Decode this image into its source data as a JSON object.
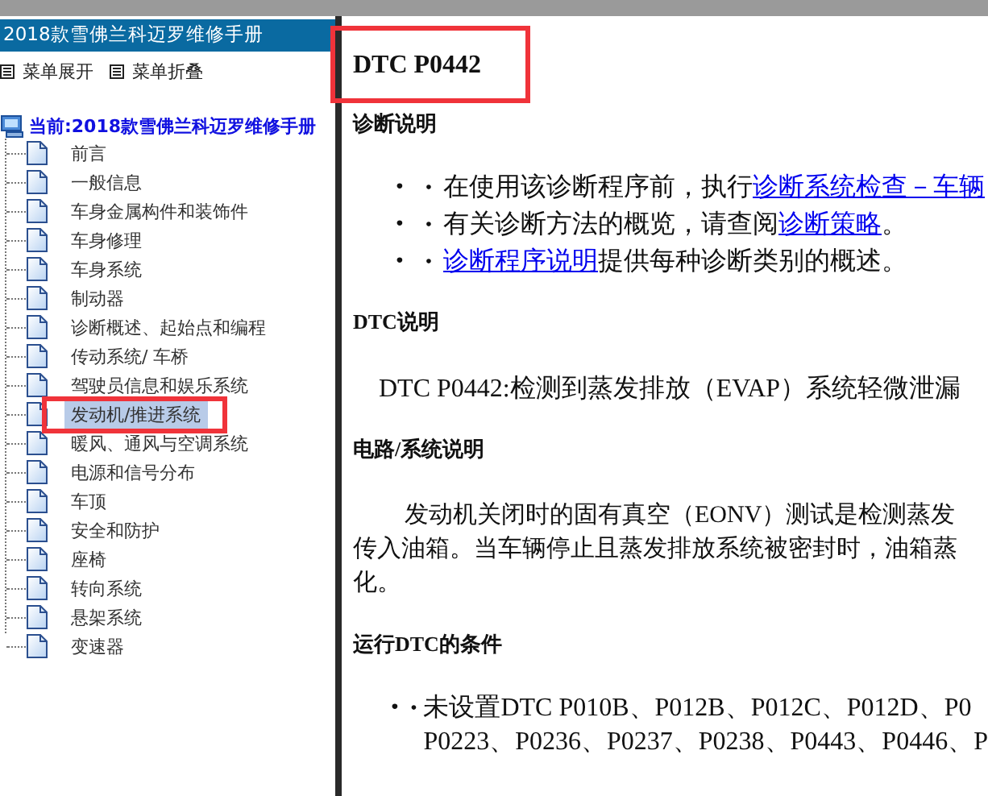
{
  "sidebar": {
    "title": "2018款雪佛兰科迈罗维修手册",
    "menu_buttons": [
      {
        "label": "菜单展开"
      },
      {
        "label": "菜单折叠"
      }
    ],
    "tree": {
      "label": "当前:2018款雪佛兰科迈罗维修手册",
      "children": [
        {
          "label": "前言",
          "selected": false
        },
        {
          "label": "一般信息",
          "selected": false
        },
        {
          "label": "车身金属构件和装饰件",
          "selected": false
        },
        {
          "label": "车身修理",
          "selected": false
        },
        {
          "label": "车身系统",
          "selected": false
        },
        {
          "label": "制动器",
          "selected": false
        },
        {
          "label": "诊断概述、起始点和编程",
          "selected": false
        },
        {
          "label": "传动系统/ 车桥",
          "selected": false
        },
        {
          "label": "驾驶员信息和娱乐系统",
          "selected": false
        },
        {
          "label": "发动机/推进系统",
          "selected": true,
          "framed": true
        },
        {
          "label": "暖风、通风与空调系统",
          "selected": false
        },
        {
          "label": "电源和信号分布",
          "selected": false
        },
        {
          "label": "车顶",
          "selected": false
        },
        {
          "label": "安全和防护",
          "selected": false
        },
        {
          "label": "座椅",
          "selected": false
        },
        {
          "label": "转向系统",
          "selected": false
        },
        {
          "label": "悬架系统",
          "selected": false
        },
        {
          "label": "变速器",
          "selected": false
        }
      ]
    }
  },
  "content": {
    "title": {
      "text": "DTC P0442",
      "framed": true
    },
    "sections": [
      {
        "heading": "诊断说明",
        "kind": "bullets",
        "items": [
          {
            "marks": [
              "•",
              "•"
            ],
            "parts": [
              {
                "text": "在使用该诊断程序前，执行"
              },
              {
                "text": "诊断系统检查－车辆",
                "link": true
              }
            ]
          },
          {
            "marks": [
              "•",
              "•"
            ],
            "parts": [
              {
                "text": "有关诊断方法的概览，请查阅"
              },
              {
                "text": "诊断策略",
                "link": true
              },
              {
                "text": "。"
              }
            ]
          },
          {
            "marks": [
              "•",
              "•"
            ],
            "parts": [
              {
                "text": "诊断程序说明",
                "link": true
              },
              {
                "text": "提供每种诊断类别的概述。"
              }
            ]
          }
        ]
      },
      {
        "heading": "DTC说明",
        "kind": "text",
        "lines": [
          "DTC P0442:检测到蒸发排放（EVAP）系统轻微泄漏"
        ]
      },
      {
        "heading": "电路/系统说明",
        "kind": "paragraph",
        "lines": [
          "发动机关闭时的固有真空（EONV）测试是检测蒸发",
          "传入油箱。当车辆停止且蒸发排放系统被密封时，油箱蒸",
          "化。"
        ]
      },
      {
        "heading": "运行DTC的条件",
        "kind": "bullets",
        "items": [
          {
            "marks": [
              "•",
              "•"
            ],
            "parts": [
              {
                "text": "未设置DTC P010B、P012B、P012C、P012D、P0"
              }
            ],
            "more": [
              "P0223、P0236、P0237、P0238、P0443、P0446、P"
            ]
          }
        ]
      }
    ]
  }
}
